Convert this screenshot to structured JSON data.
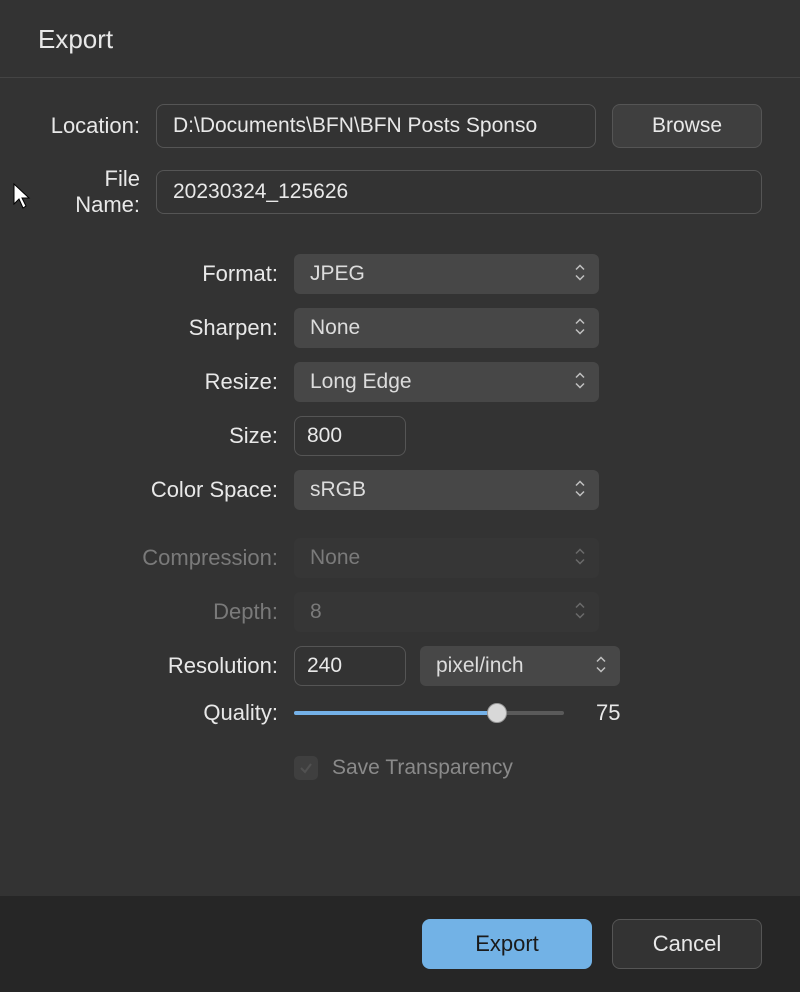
{
  "title": "Export",
  "location": {
    "label": "Location:",
    "value": "D:\\Documents\\BFN\\BFN Posts Sponso",
    "browse": "Browse"
  },
  "filename": {
    "label": "File Name:",
    "value": "20230324_125626"
  },
  "options": {
    "format": {
      "label": "Format:",
      "value": "JPEG"
    },
    "sharpen": {
      "label": "Sharpen:",
      "value": "None"
    },
    "resize": {
      "label": "Resize:",
      "value": "Long Edge"
    },
    "size": {
      "label": "Size:",
      "value": "800"
    },
    "colorspace": {
      "label": "Color Space:",
      "value": "sRGB"
    },
    "compression": {
      "label": "Compression:",
      "value": "None"
    },
    "depth": {
      "label": "Depth:",
      "value": "8"
    },
    "resolution": {
      "label": "Resolution:",
      "value": "240",
      "unit": "pixel/inch"
    },
    "quality": {
      "label": "Quality:",
      "value": "75"
    },
    "transparency": {
      "label": "Save Transparency"
    }
  },
  "buttons": {
    "export": "Export",
    "cancel": "Cancel"
  }
}
